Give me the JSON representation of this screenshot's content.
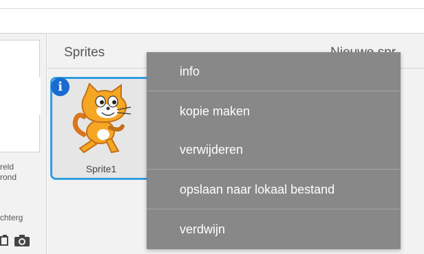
{
  "stage": {
    "caption": "reld\nrond",
    "new_backdrop_label": "chterg"
  },
  "sprites": {
    "title": "Sprites",
    "new_sprite_label": "Nieuwe spr"
  },
  "sprite_tile": {
    "name": "Sprite1",
    "info_glyph": "i"
  },
  "context_menu": {
    "items": [
      {
        "label": "info"
      },
      {
        "label": "kopie maken"
      },
      {
        "label": "verwijderen"
      },
      {
        "label": "opslaan naar lokaal bestand"
      },
      {
        "label": "verdwijn"
      }
    ]
  },
  "colors": {
    "selection": "#2f9de2",
    "info_badge": "#1a6ad1",
    "menu_bg": "#888888"
  },
  "icons": {
    "paint": "paint-icon",
    "camera": "camera-icon"
  }
}
